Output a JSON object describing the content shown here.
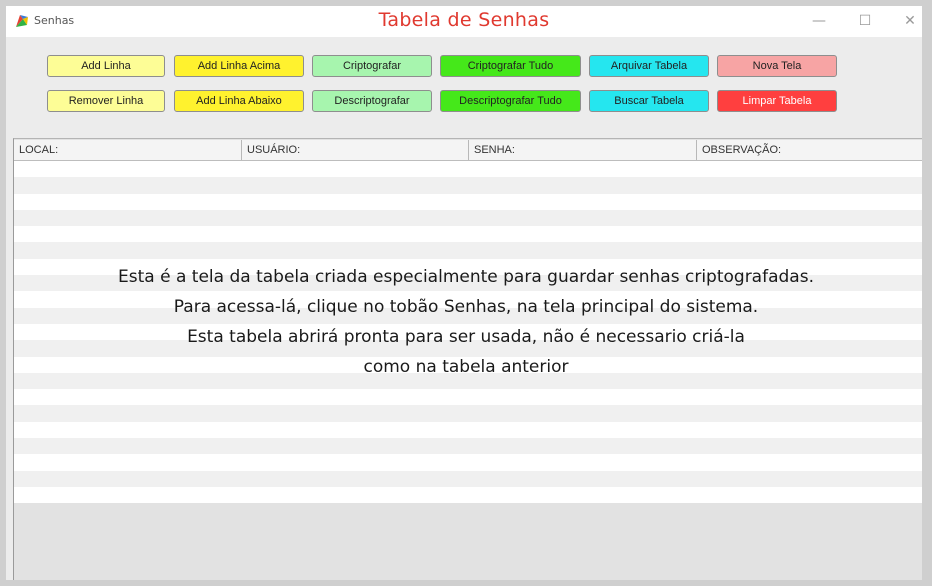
{
  "window": {
    "title": "Senhas",
    "overlay_title": "Tabela de Senhas",
    "controls": {
      "minimize": "—",
      "maximize": "☐",
      "close": "✕"
    }
  },
  "toolbar": {
    "add_linha": "Add Linha",
    "add_linha_acima": "Add Linha Acima",
    "criptografar": "Criptografar",
    "criptografar_tudo": "Criptografar Tudo",
    "arquivar_tabela": "Arquivar Tabela",
    "nova_tela": "Nova Tela",
    "remover_linha": "Remover Linha",
    "add_linha_abaixo": "Add Linha Abaixo",
    "descriptografar": "Descriptografar",
    "descriptografar_tudo": "Descriptografar Tudo",
    "buscar_tabela": "Buscar Tabela",
    "limpar_tabela": "Limpar Tabela"
  },
  "table": {
    "columns": [
      "LOCAL:",
      "USUÁRIO:",
      "SENHA:",
      "OBSERVAÇÃO:"
    ],
    "rows": []
  },
  "caption": {
    "line1": "Esta é a tela da tabela criada especialmente para guardar senhas criptografadas.",
    "line2": "Para acessa-lá, clique no tobão Senhas, na tela principal do sistema.",
    "line3": "Esta tabela abrirá pronta para ser usada, não é necessario criá-la",
    "line4": "como na tabela anterior"
  },
  "colors": {
    "overlay_title": "#e0392f",
    "light_yellow": "#fdfd96",
    "yellow": "#fff22e",
    "light_green": "#a7f5ae",
    "green": "#45e81a",
    "cyan": "#25e6ef",
    "pink": "#f7a4a4",
    "red": "#ff3f3f"
  },
  "icons": {
    "app": "app-logo-icon"
  }
}
